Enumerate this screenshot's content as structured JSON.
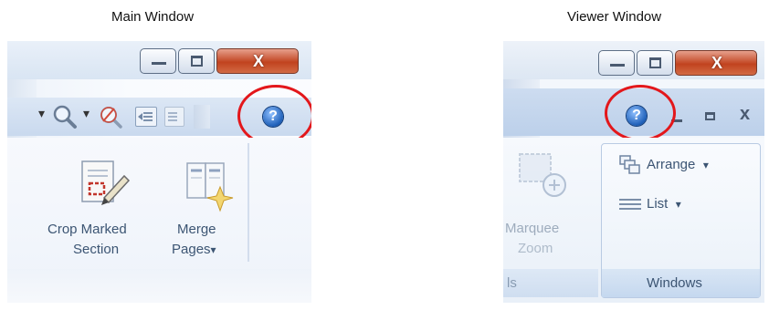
{
  "captions": {
    "main": "Main Window",
    "viewer": "Viewer Window"
  },
  "main_window": {
    "title_buttons": {
      "minimize": "—",
      "maximize": "□",
      "close": "X"
    },
    "toolbar": {
      "zoom_dropdown_arrow": "▾",
      "zoom_dropdown_arrow_2": "▾",
      "help_glyph": "?"
    },
    "ribbon": {
      "crop_line1": "Crop Marked",
      "crop_line2": "Section",
      "merge_line1": "Merge",
      "merge_line2": "Pages",
      "merge_arrow": "▾"
    }
  },
  "viewer_window": {
    "title_buttons": {
      "minimize": "—",
      "maximize": "□",
      "close": "X"
    },
    "inner_controls": {
      "help_glyph": "?",
      "minimize": "_",
      "restore": "▭",
      "close": "x"
    },
    "ribbon": {
      "marquee_line1": "Marquee",
      "marquee_line2": "Zoom",
      "arrange_label": "Arrange",
      "list_label": "List",
      "group_label": "Windows",
      "left_group_fragment": "ls",
      "dropdown_arrow": "▾"
    }
  },
  "colors": {
    "highlight_ring": "#e3171b",
    "help_blue": "#1e5fb8",
    "ribbon_text": "#3c5573",
    "close_red": "#c1431f"
  }
}
